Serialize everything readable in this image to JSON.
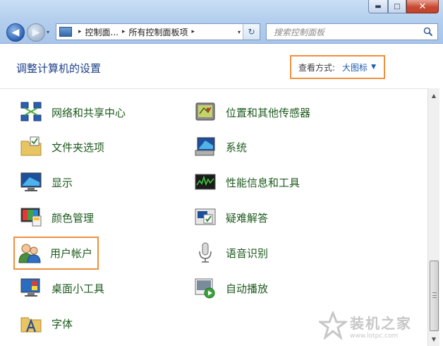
{
  "window": {
    "controls": {
      "minimize": "▬",
      "maximize": "□",
      "close": "✕"
    }
  },
  "address_bar": {
    "breadcrumbs": [
      "控制面...",
      "所有控制面板项"
    ],
    "separator": "▸",
    "dropdown_glyph": "▾",
    "refresh_glyph": "↻"
  },
  "search": {
    "placeholder": "搜索控制面板"
  },
  "header": {
    "title": "调整计算机的设置",
    "view_label": "查看方式:",
    "view_value": "大图标",
    "view_arrow": "▼"
  },
  "items_left": [
    {
      "label": "网络和共享中心",
      "icon": "network-center-icon"
    },
    {
      "label": "文件夹选项",
      "icon": "folder-options-icon"
    },
    {
      "label": "显示",
      "icon": "display-icon"
    },
    {
      "label": "颜色管理",
      "icon": "color-management-icon"
    },
    {
      "label": "用户帐户",
      "icon": "user-accounts-icon"
    },
    {
      "label": "桌面小工具",
      "icon": "desktop-gadgets-icon"
    },
    {
      "label": "字体",
      "icon": "fonts-icon"
    }
  ],
  "items_right": [
    {
      "label": "位置和其他传感器",
      "icon": "location-sensors-icon"
    },
    {
      "label": "系统",
      "icon": "system-icon"
    },
    {
      "label": "性能信息和工具",
      "icon": "performance-icon"
    },
    {
      "label": "疑难解答",
      "icon": "troubleshooting-icon"
    },
    {
      "label": "语音识别",
      "icon": "microphone-icon"
    },
    {
      "label": "自动播放",
      "icon": "autoplay-icon"
    }
  ],
  "watermark": {
    "name": "装机之家",
    "url": "www.lotpc.com"
  },
  "colors": {
    "accent_highlight": "#f0903f",
    "link_green": "#1d5a1d",
    "title_blue": "#1c3f8a"
  }
}
